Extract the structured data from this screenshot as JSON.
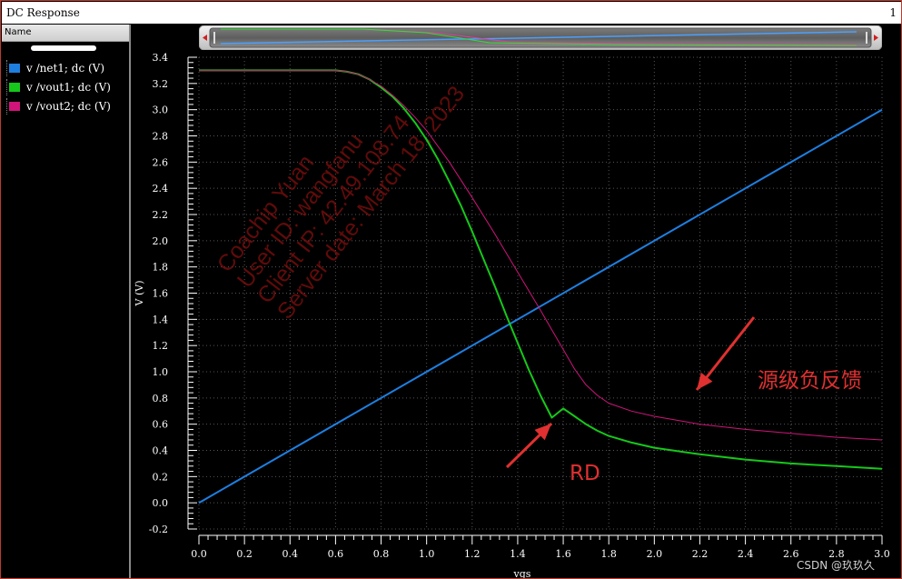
{
  "window": {
    "title": "DC Response",
    "number": "1"
  },
  "legend_panel": {
    "header": "Name",
    "items": [
      {
        "label": "v /net1; dc (V)",
        "color": "#1e7fe0"
      },
      {
        "label": "v /vout1; dc (V)",
        "color": "#16c81a"
      },
      {
        "label": "v /vout2; dc (V)",
        "color": "#d0147a"
      }
    ]
  },
  "watermark": [
    "Coachip Yuan",
    "User ID: wangfanu",
    "Client IP: 42.49.108.74",
    "Server date: March 18, 2023"
  ],
  "annotations": [
    {
      "text": "源级负反馈",
      "color": "#e03030"
    },
    {
      "text": "RD",
      "color": "#e03030"
    }
  ],
  "credit": "CSDN @玖玖久",
  "chart_data": {
    "type": "line",
    "title": "",
    "xlabel": "vgs",
    "ylabel": "V (V)",
    "xlim": [
      0.0,
      3.0
    ],
    "ylim": [
      -0.2,
      3.4
    ],
    "xticks": [
      "0.0",
      "0.2",
      "0.4",
      "0.6",
      "0.8",
      "1.0",
      "1.2",
      "1.4",
      "1.6",
      "1.8",
      "2.0",
      "2.2",
      "2.4",
      "2.6",
      "2.8",
      "3.0"
    ],
    "yticks": [
      "-0.2",
      "0.0",
      "0.2",
      "0.4",
      "0.6",
      "0.8",
      "1.0",
      "1.2",
      "1.4",
      "1.6",
      "1.8",
      "2.0",
      "2.2",
      "2.4",
      "2.6",
      "2.8",
      "3.0",
      "3.2",
      "3.4"
    ],
    "grid": true,
    "series": [
      {
        "name": "v /net1; dc (V)",
        "color": "#1e7fe0",
        "x": [
          0.0,
          3.0
        ],
        "y": [
          0.0,
          3.0
        ]
      },
      {
        "name": "v /vout1; dc (V)",
        "color": "#16c81a",
        "x": [
          0.0,
          0.6,
          0.65,
          0.7,
          0.75,
          0.8,
          0.85,
          0.9,
          0.95,
          1.0,
          1.05,
          1.1,
          1.15,
          1.2,
          1.25,
          1.3,
          1.35,
          1.4,
          1.45,
          1.5,
          1.55,
          1.6,
          1.65,
          1.7,
          1.75,
          1.8,
          1.9,
          2.0,
          2.2,
          2.4,
          2.6,
          2.8,
          3.0
        ],
        "y": [
          3.3,
          3.3,
          3.29,
          3.27,
          3.23,
          3.17,
          3.1,
          3.01,
          2.9,
          2.77,
          2.62,
          2.45,
          2.27,
          2.07,
          1.86,
          1.65,
          1.43,
          1.22,
          1.01,
          0.82,
          0.65,
          0.72,
          0.66,
          0.6,
          0.55,
          0.51,
          0.46,
          0.42,
          0.37,
          0.33,
          0.3,
          0.28,
          0.26
        ]
      },
      {
        "name": "v /vout2; dc (V)",
        "color": "#d0147a",
        "x": [
          0.0,
          0.6,
          0.65,
          0.7,
          0.75,
          0.8,
          0.85,
          0.9,
          0.95,
          1.0,
          1.1,
          1.2,
          1.3,
          1.4,
          1.5,
          1.55,
          1.6,
          1.65,
          1.7,
          1.75,
          1.8,
          1.9,
          2.0,
          2.2,
          2.4,
          2.6,
          2.8,
          3.0
        ],
        "y": [
          3.3,
          3.3,
          3.29,
          3.27,
          3.23,
          3.18,
          3.11,
          3.03,
          2.94,
          2.84,
          2.6,
          2.33,
          2.05,
          1.76,
          1.47,
          1.32,
          1.17,
          1.02,
          0.9,
          0.82,
          0.76,
          0.7,
          0.66,
          0.6,
          0.56,
          0.53,
          0.5,
          0.48
        ]
      }
    ]
  }
}
